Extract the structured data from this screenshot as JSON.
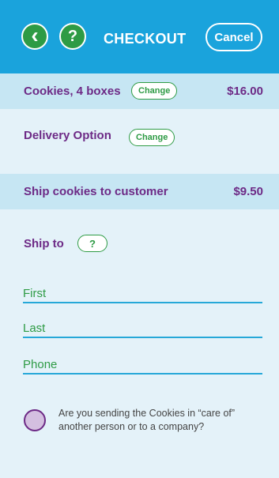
{
  "header": {
    "back_icon": "chevron-left-icon",
    "back_glyph": "‹",
    "help_glyph": "?",
    "title": "CHECKOUT",
    "cancel_label": "Cancel"
  },
  "order": {
    "item_label": "Cookies, 4 boxes",
    "item_change_label": "Change",
    "item_price": "$16.00",
    "delivery_label": "Delivery Option",
    "delivery_change_label": "Change",
    "shipping_label": "Ship cookies to customer",
    "shipping_price": "$9.50"
  },
  "ship_to": {
    "label": "Ship to",
    "help_glyph": "?"
  },
  "form": {
    "first_placeholder": "First",
    "last_placeholder": "Last",
    "phone_placeholder": "Phone"
  },
  "care_of": {
    "question": "Are you sending the Cookies in “care of” another person or to a company?",
    "checked": false
  },
  "colors": {
    "header": "#1aa3dc",
    "accent_green": "#2e9b45",
    "label_purple": "#6d2a86",
    "band": "#c6e6f3",
    "background": "#e4f2f9"
  }
}
